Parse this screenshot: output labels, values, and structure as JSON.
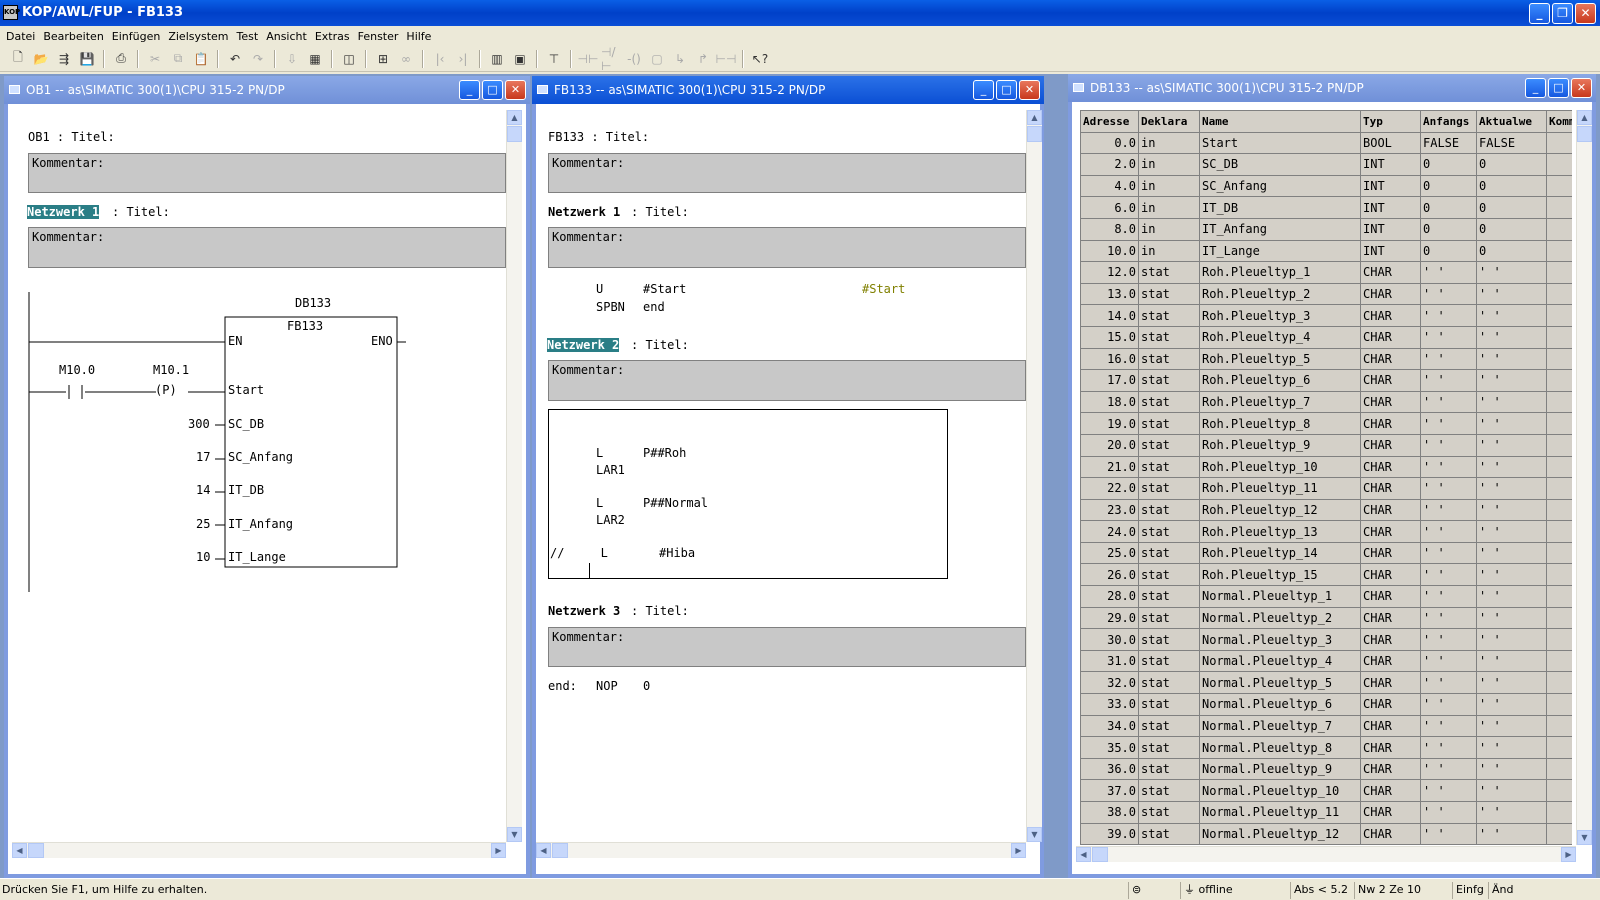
{
  "app": {
    "title": "KOP/AWL/FUP  - FB133",
    "icon_text": "KOP"
  },
  "menu": [
    "Datei",
    "Bearbeiten",
    "Einfügen",
    "Zielsystem",
    "Test",
    "Ansicht",
    "Extras",
    "Fenster",
    "Hilfe"
  ],
  "window_controls": {
    "minimize": "_",
    "maximize": "□",
    "close": "✕",
    "restore": "❐"
  },
  "ob1": {
    "title": "OB1 -- as\\SIMATIC 300(1)\\CPU 315-2 PN/DP",
    "block_header": "OB1 : Titel:",
    "comment_label": "Kommentar:",
    "network_label": "Netzwerk 1",
    "network_title": ": Titel:",
    "network_comment": "Kommentar:",
    "fb": {
      "db": "DB133",
      "name": "FB133",
      "en": "EN",
      "eno": "ENO",
      "contacts": [
        {
          "addr": "M10.0",
          "sym": "| |"
        },
        {
          "addr": "M10.1",
          "sym": "(P)"
        }
      ],
      "inputs": [
        {
          "pin": "Start",
          "value": ""
        },
        {
          "pin": "SC_DB",
          "value": "300"
        },
        {
          "pin": "SC_Anfang",
          "value": "17"
        },
        {
          "pin": "IT_DB",
          "value": "14"
        },
        {
          "pin": "IT_Anfang",
          "value": "25"
        },
        {
          "pin": "IT_Lange",
          "value": "10"
        }
      ]
    }
  },
  "fb133": {
    "title": "FB133 -- as\\SIMATIC 300(1)\\CPU 315-2 PN/DP",
    "block_header": "FB133 : Titel:",
    "comment_label": "Kommentar:",
    "n1": {
      "label": "Netzwerk 1",
      "title": ": Titel:",
      "comment": "Kommentar:",
      "lines": [
        {
          "op": "U",
          "arg": "#Start",
          "sym": "#Start"
        },
        {
          "op": "SPBN",
          "arg": "end",
          "sym": ""
        }
      ]
    },
    "n2": {
      "label": "Netzwerk 2",
      "title": ": Titel:",
      "comment": "Kommentar:",
      "lines": [
        {
          "op": "L",
          "arg": "P##Roh"
        },
        {
          "op": "LAR1",
          "arg": ""
        },
        {
          "op": "L",
          "arg": "P##Normal"
        },
        {
          "op": "LAR2",
          "arg": ""
        },
        {
          "op": "//     L",
          "arg": "#Hiba"
        }
      ]
    },
    "n3": {
      "label": "Netzwerk 3",
      "title": ": Titel:",
      "comment": "Kommentar:"
    },
    "end_line": {
      "label": "end:",
      "op": "NOP",
      "arg": "0"
    }
  },
  "db133": {
    "title": "DB133 -- as\\SIMATIC 300(1)\\CPU 315-2 PN/DP",
    "headers": [
      "Adresse",
      "Deklara",
      "Name",
      "Typ",
      "Anfangs",
      "Aktualwe",
      "Komm"
    ],
    "rows": [
      [
        "0.0",
        "in",
        "Start",
        "BOOL",
        "FALSE",
        "FALSE"
      ],
      [
        "2.0",
        "in",
        "SC_DB",
        "INT",
        "0",
        "0"
      ],
      [
        "4.0",
        "in",
        "SC_Anfang",
        "INT",
        "0",
        "0"
      ],
      [
        "6.0",
        "in",
        "IT_DB",
        "INT",
        "0",
        "0"
      ],
      [
        "8.0",
        "in",
        "IT_Anfang",
        "INT",
        "0",
        "0"
      ],
      [
        "10.0",
        "in",
        "IT_Lange",
        "INT",
        "0",
        "0"
      ],
      [
        "12.0",
        "stat",
        "Roh.Pleueltyp_1",
        "CHAR",
        "' '",
        "' '"
      ],
      [
        "13.0",
        "stat",
        "Roh.Pleueltyp_2",
        "CHAR",
        "' '",
        "' '"
      ],
      [
        "14.0",
        "stat",
        "Roh.Pleueltyp_3",
        "CHAR",
        "' '",
        "' '"
      ],
      [
        "15.0",
        "stat",
        "Roh.Pleueltyp_4",
        "CHAR",
        "' '",
        "' '"
      ],
      [
        "16.0",
        "stat",
        "Roh.Pleueltyp_5",
        "CHAR",
        "' '",
        "' '"
      ],
      [
        "17.0",
        "stat",
        "Roh.Pleueltyp_6",
        "CHAR",
        "' '",
        "' '"
      ],
      [
        "18.0",
        "stat",
        "Roh.Pleueltyp_7",
        "CHAR",
        "' '",
        "' '"
      ],
      [
        "19.0",
        "stat",
        "Roh.Pleueltyp_8",
        "CHAR",
        "' '",
        "' '"
      ],
      [
        "20.0",
        "stat",
        "Roh.Pleueltyp_9",
        "CHAR",
        "' '",
        "' '"
      ],
      [
        "21.0",
        "stat",
        "Roh.Pleueltyp_10",
        "CHAR",
        "' '",
        "' '"
      ],
      [
        "22.0",
        "stat",
        "Roh.Pleueltyp_11",
        "CHAR",
        "' '",
        "' '"
      ],
      [
        "23.0",
        "stat",
        "Roh.Pleueltyp_12",
        "CHAR",
        "' '",
        "' '"
      ],
      [
        "24.0",
        "stat",
        "Roh.Pleueltyp_13",
        "CHAR",
        "' '",
        "' '"
      ],
      [
        "25.0",
        "stat",
        "Roh.Pleueltyp_14",
        "CHAR",
        "' '",
        "' '"
      ],
      [
        "26.0",
        "stat",
        "Roh.Pleueltyp_15",
        "CHAR",
        "' '",
        "' '"
      ],
      [
        "28.0",
        "stat",
        "Normal.Pleueltyp_1",
        "CHAR",
        "' '",
        "' '"
      ],
      [
        "29.0",
        "stat",
        "Normal.Pleueltyp_2",
        "CHAR",
        "' '",
        "' '"
      ],
      [
        "30.0",
        "stat",
        "Normal.Pleueltyp_3",
        "CHAR",
        "' '",
        "' '"
      ],
      [
        "31.0",
        "stat",
        "Normal.Pleueltyp_4",
        "CHAR",
        "' '",
        "' '"
      ],
      [
        "32.0",
        "stat",
        "Normal.Pleueltyp_5",
        "CHAR",
        "' '",
        "' '"
      ],
      [
        "33.0",
        "stat",
        "Normal.Pleueltyp_6",
        "CHAR",
        "' '",
        "' '"
      ],
      [
        "34.0",
        "stat",
        "Normal.Pleueltyp_7",
        "CHAR",
        "' '",
        "' '"
      ],
      [
        "35.0",
        "stat",
        "Normal.Pleueltyp_8",
        "CHAR",
        "' '",
        "' '"
      ],
      [
        "36.0",
        "stat",
        "Normal.Pleueltyp_9",
        "CHAR",
        "' '",
        "' '"
      ],
      [
        "37.0",
        "stat",
        "Normal.Pleueltyp_10",
        "CHAR",
        "' '",
        "' '"
      ],
      [
        "38.0",
        "stat",
        "Normal.Pleueltyp_11",
        "CHAR",
        "' '",
        "' '"
      ],
      [
        "39.0",
        "stat",
        "Normal.Pleueltyp_12",
        "CHAR",
        "' '",
        "' '"
      ]
    ]
  },
  "status": {
    "help": "Drücken Sie F1, um Hilfe zu erhalten.",
    "mode": "offline",
    "abs": "Abs < 5.2",
    "pos": "Nw 2  Ze 10",
    "ins": "Einfg",
    "chg": "Änd"
  }
}
